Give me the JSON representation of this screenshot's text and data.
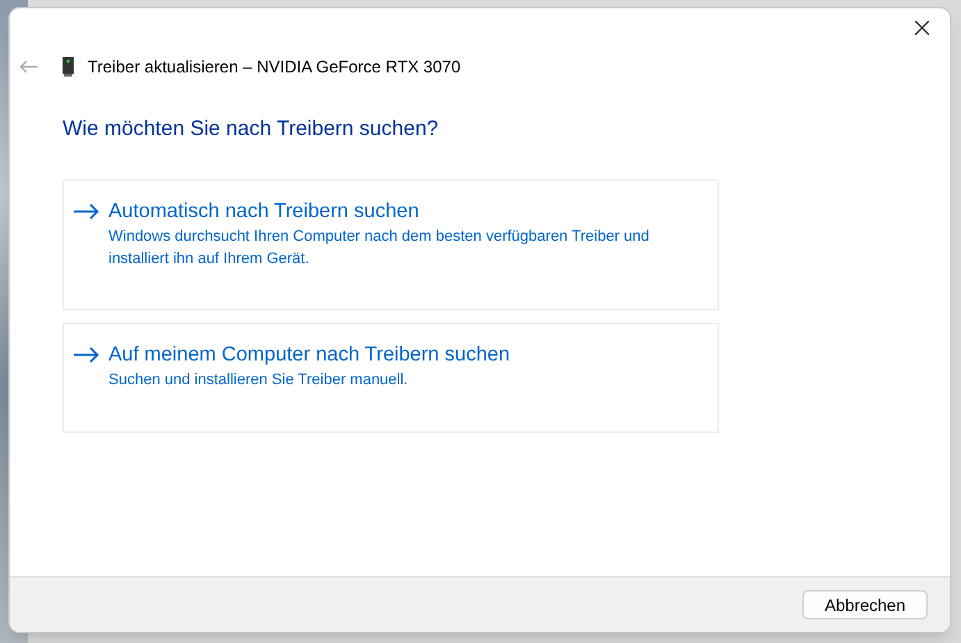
{
  "dialog": {
    "title": "Treiber aktualisieren – NVIDIA GeForce RTX 3070",
    "heading": "Wie möchten Sie nach Treibern suchen?",
    "options": [
      {
        "title": "Automatisch nach Treibern suchen",
        "description": "Windows durchsucht Ihren Computer nach dem besten verfügbaren Treiber und installiert ihn auf Ihrem Gerät."
      },
      {
        "title": "Auf meinem Computer nach Treibern suchen",
        "description": "Suchen und installieren Sie Treiber manuell."
      }
    ],
    "buttons": [
      "Abbrechen"
    ]
  }
}
